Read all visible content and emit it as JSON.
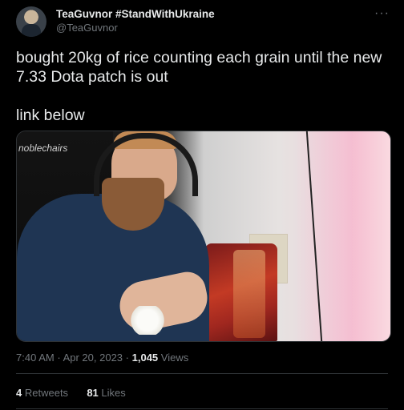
{
  "author": {
    "display_name": "TeaGuvnor #StandWithUkraine",
    "handle": "@TeaGuvnor",
    "more_icon": "ellipsis-icon"
  },
  "tweet": {
    "text": "bought 20kg of rice counting each grain until the new 7.33 Dota patch is out\n\nlink below"
  },
  "media": {
    "watermark": "noblechairs"
  },
  "meta": {
    "time": "7:40 AM",
    "separator1": "·",
    "date": "Apr 20, 2023",
    "separator2": "·",
    "views_count": "1,045",
    "views_label": "Views"
  },
  "stats": {
    "retweets_count": "4",
    "retweets_label": "Retweets",
    "likes_count": "81",
    "likes_label": "Likes"
  }
}
